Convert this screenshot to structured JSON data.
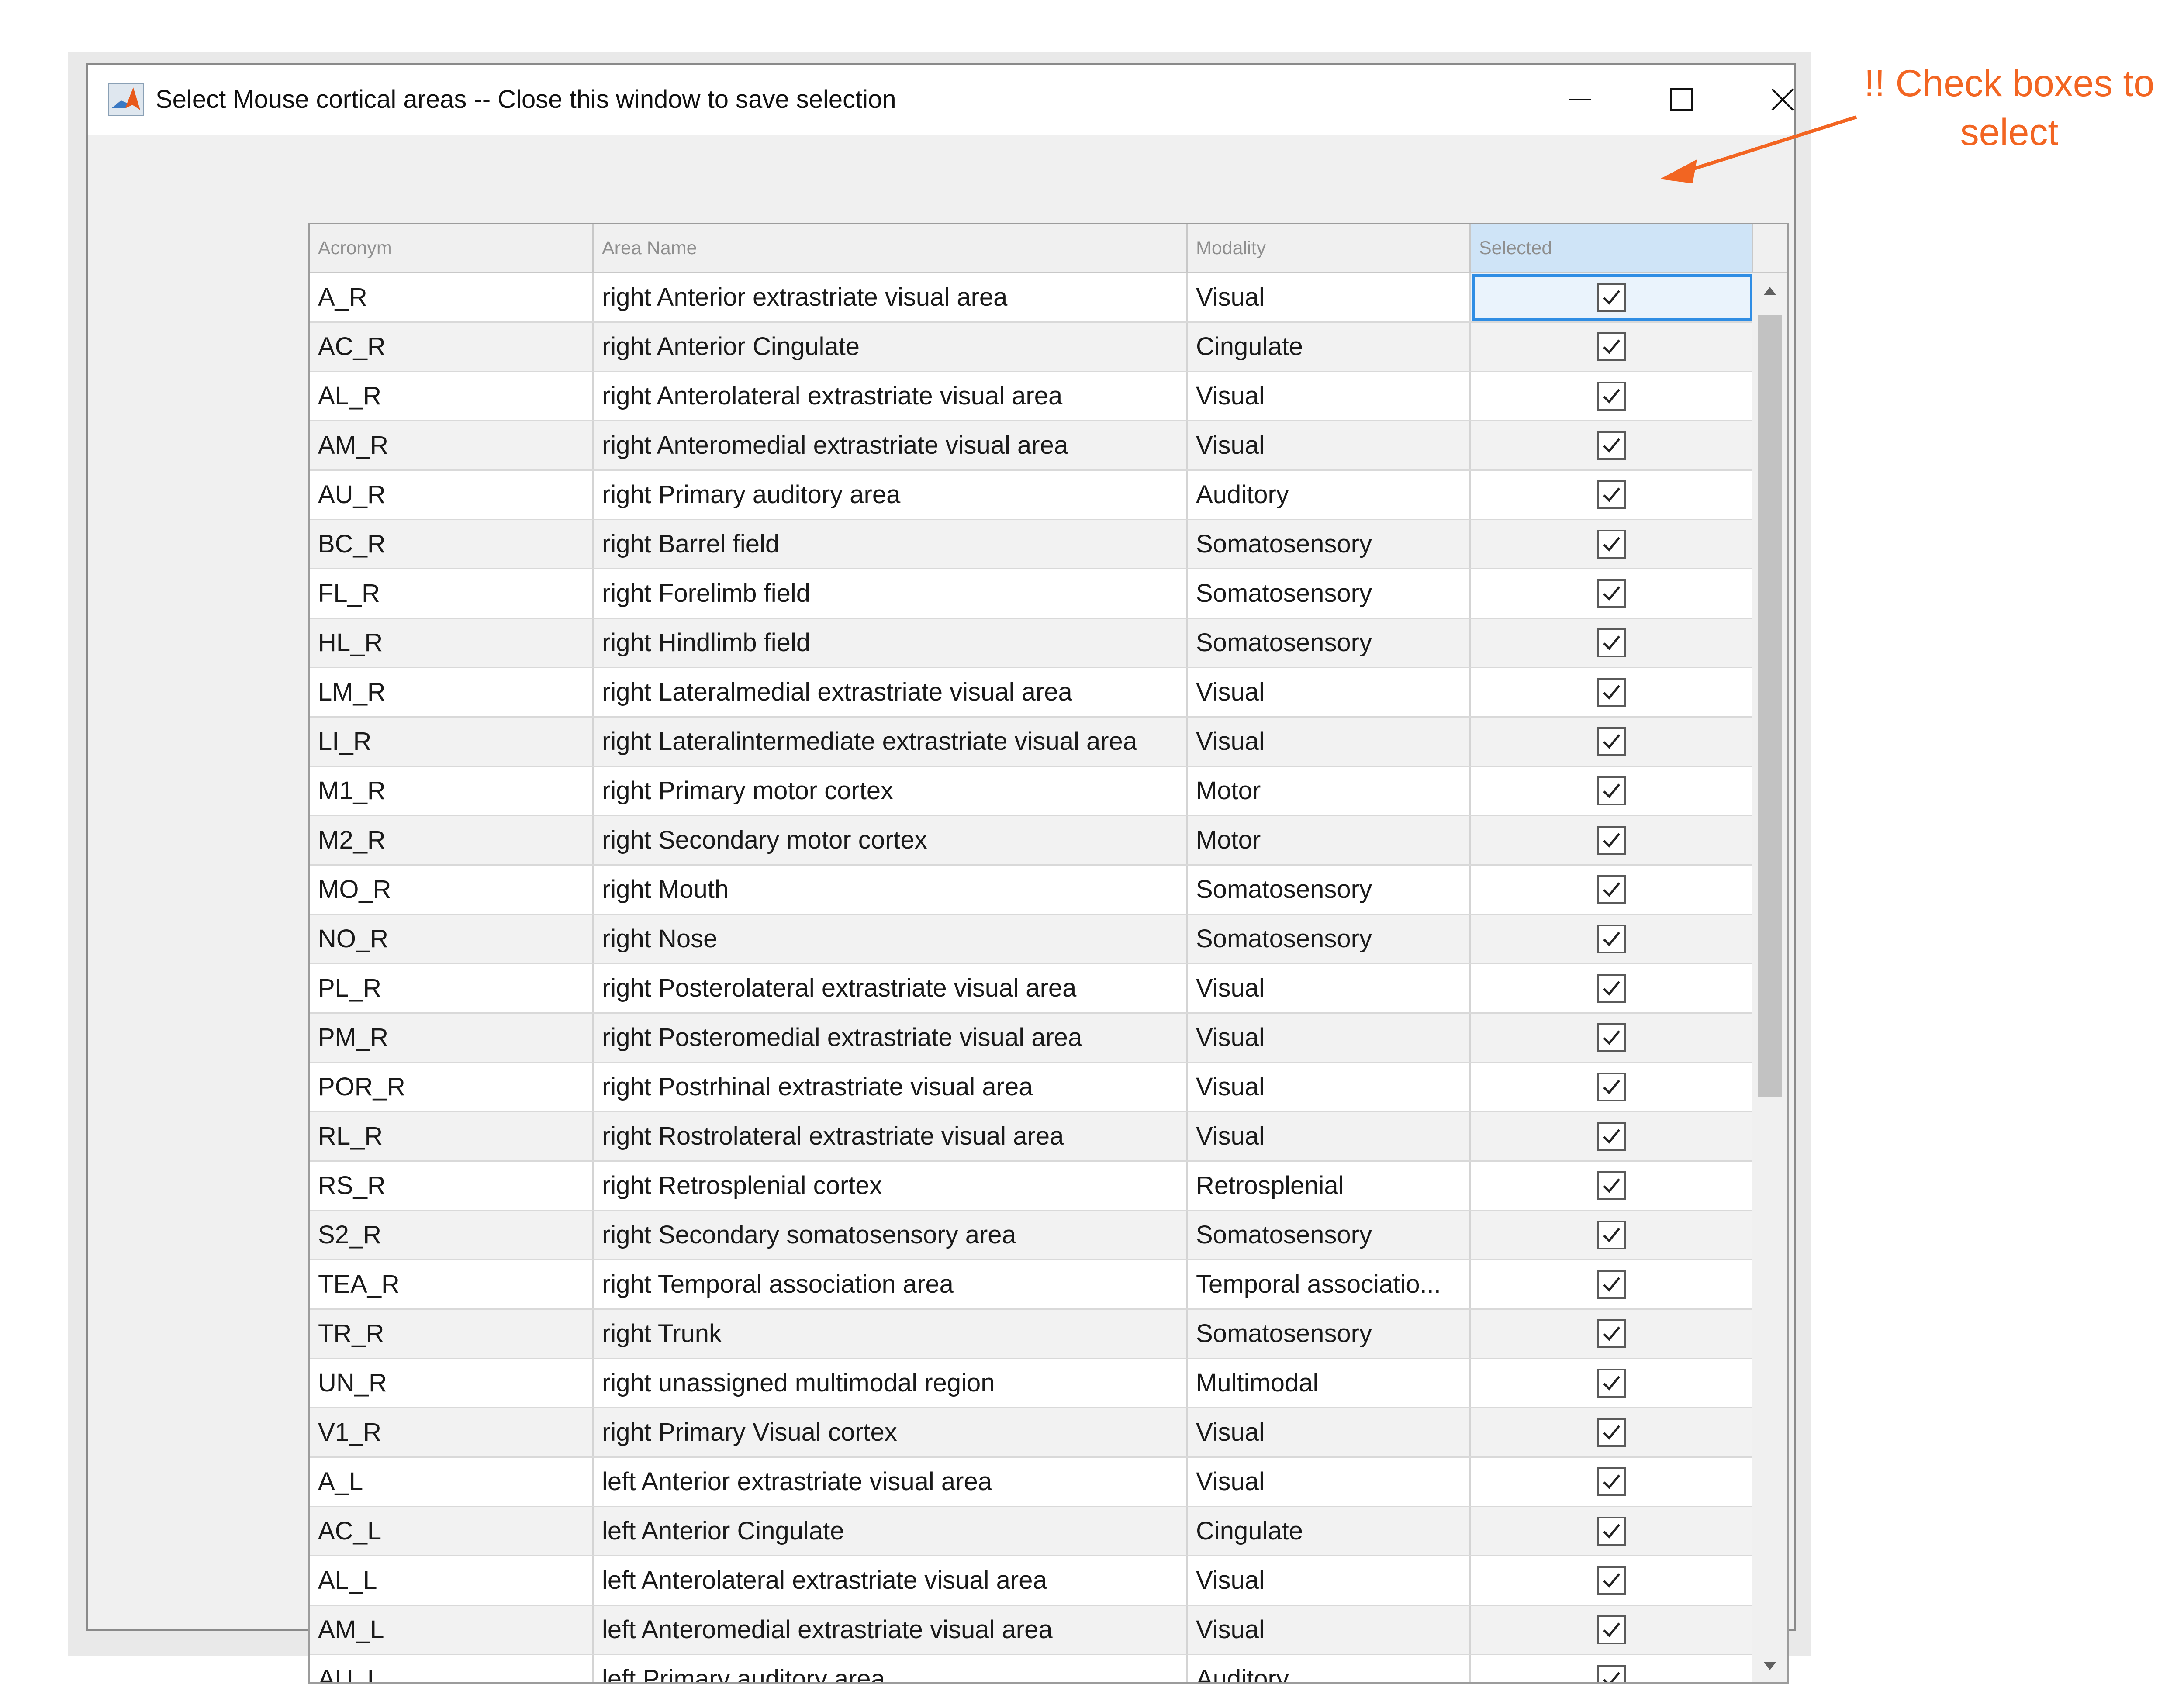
{
  "window": {
    "title": "Select Mouse cortical areas -- Close this window to save selection",
    "icon": "matlab-icon",
    "controls": [
      "minimize-icon",
      "maximize-icon",
      "close-icon"
    ]
  },
  "annotation": {
    "text": "!! Check boxes to select",
    "color": "#f26522"
  },
  "table": {
    "columns": [
      "Acronym",
      "Area Name",
      "Modality",
      "Selected"
    ],
    "rows": [
      {
        "acronym": "A_R",
        "name": "right Anterior extrastriate visual area",
        "modality": "Visual",
        "selected": true
      },
      {
        "acronym": "AC_R",
        "name": "right Anterior Cingulate",
        "modality": "Cingulate",
        "selected": true
      },
      {
        "acronym": "AL_R",
        "name": "right Anterolateral extrastriate visual area",
        "modality": "Visual",
        "selected": true
      },
      {
        "acronym": "AM_R",
        "name": "right Anteromedial extrastriate visual area",
        "modality": "Visual",
        "selected": true
      },
      {
        "acronym": "AU_R",
        "name": "right Primary auditory area",
        "modality": "Auditory",
        "selected": true
      },
      {
        "acronym": "BC_R",
        "name": "right Barrel field",
        "modality": "Somatosensory",
        "selected": true
      },
      {
        "acronym": "FL_R",
        "name": "right Forelimb field",
        "modality": "Somatosensory",
        "selected": true
      },
      {
        "acronym": "HL_R",
        "name": "right Hindlimb field",
        "modality": "Somatosensory",
        "selected": true
      },
      {
        "acronym": "LM_R",
        "name": "right Lateralmedial extrastriate visual area",
        "modality": "Visual",
        "selected": true
      },
      {
        "acronym": "LI_R",
        "name": "right Lateralintermediate extrastriate visual area",
        "modality": "Visual",
        "selected": true
      },
      {
        "acronym": "M1_R",
        "name": "right Primary motor cortex",
        "modality": "Motor",
        "selected": true
      },
      {
        "acronym": "M2_R",
        "name": "right Secondary motor cortex",
        "modality": "Motor",
        "selected": true
      },
      {
        "acronym": "MO_R",
        "name": "right Mouth",
        "modality": "Somatosensory",
        "selected": true
      },
      {
        "acronym": "NO_R",
        "name": "right Nose",
        "modality": "Somatosensory",
        "selected": true
      },
      {
        "acronym": "PL_R",
        "name": "right Posterolateral extrastriate visual area",
        "modality": "Visual",
        "selected": true
      },
      {
        "acronym": "PM_R",
        "name": "right Posteromedial extrastriate visual area",
        "modality": "Visual",
        "selected": true
      },
      {
        "acronym": "POR_R",
        "name": "right Postrhinal extrastriate visual area",
        "modality": "Visual",
        "selected": true
      },
      {
        "acronym": "RL_R",
        "name": "right Rostrolateral extrastriate visual area",
        "modality": "Visual",
        "selected": true
      },
      {
        "acronym": "RS_R",
        "name": "right Retrosplenial cortex",
        "modality": "Retrosplenial",
        "selected": true
      },
      {
        "acronym": "S2_R",
        "name": "right Secondary somatosensory area",
        "modality": "Somatosensory",
        "selected": true
      },
      {
        "acronym": "TEA_R",
        "name": "right Temporal association area",
        "modality": "Temporal associatio...",
        "selected": true
      },
      {
        "acronym": "TR_R",
        "name": "right Trunk",
        "modality": "Somatosensory",
        "selected": true
      },
      {
        "acronym": "UN_R",
        "name": "right unassigned multimodal region",
        "modality": "Multimodal",
        "selected": true
      },
      {
        "acronym": "V1_R",
        "name": "right Primary Visual cortex",
        "modality": "Visual",
        "selected": true
      },
      {
        "acronym": "A_L",
        "name": "left Anterior extrastriate visual area",
        "modality": "Visual",
        "selected": true
      },
      {
        "acronym": "AC_L",
        "name": "left Anterior Cingulate",
        "modality": "Cingulate",
        "selected": true
      },
      {
        "acronym": "AL_L",
        "name": "left Anterolateral extrastriate visual area",
        "modality": "Visual",
        "selected": true
      },
      {
        "acronym": "AM_L",
        "name": "left Anteromedial extrastriate visual area",
        "modality": "Visual",
        "selected": true
      },
      {
        "acronym": "AU_L",
        "name": "left Primary auditory area",
        "modality": "Auditory",
        "selected": true
      }
    ]
  }
}
